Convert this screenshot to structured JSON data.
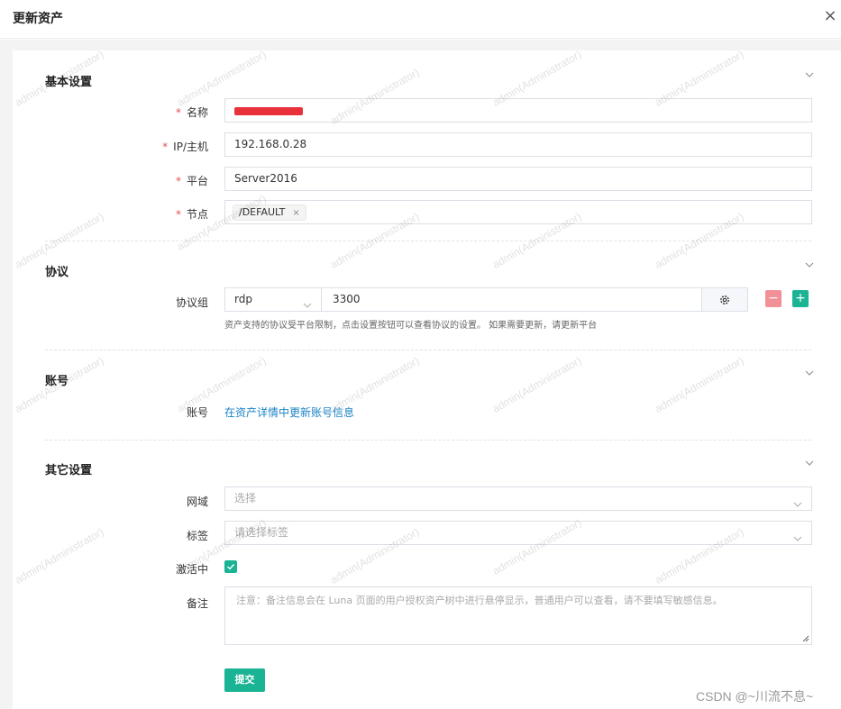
{
  "dialog": {
    "title": "更新资产",
    "close": "×"
  },
  "watermark": "admin(Administrator)",
  "sections": {
    "basic": "基本设置",
    "protocol": "协议",
    "account": "账号",
    "other": "其它设置"
  },
  "basic": {
    "name_label": "名称",
    "host_label": "IP/主机",
    "host_value": "192.168.0.28",
    "platform_label": "平台",
    "platform_value": "Server2016",
    "node_label": "节点",
    "node_tag": "/DEFAULT",
    "node_tag_remove": "×",
    "required_mark": "*"
  },
  "protocol": {
    "label": "协议组",
    "name": "rdp",
    "port": "3300",
    "minus": "−",
    "plus": "+",
    "help": "资产支持的协议受平台限制，点击设置按钮可以查看协议的设置。 如果需要更新，请更新平台"
  },
  "account": {
    "label": "账号",
    "link": "在资产详情中更新账号信息"
  },
  "other": {
    "domain_label": "网域",
    "domain_placeholder": "选择",
    "labels_label": "标签",
    "labels_placeholder": "请选择标签",
    "active_label": "激活中",
    "active_checked": true,
    "comment_label": "备注",
    "comment_placeholder": "注意：备注信息会在 Luna 页面的用户授权资产树中进行悬停显示，普通用户可以查看，请不要填写敏感信息。"
  },
  "submit_label": "提交",
  "csdn_watermark": "CSDN @~川流不息~",
  "colors": {
    "primary": "#1ab394",
    "danger": "#f29097",
    "link": "#1c84c6",
    "required": "#e55252"
  }
}
